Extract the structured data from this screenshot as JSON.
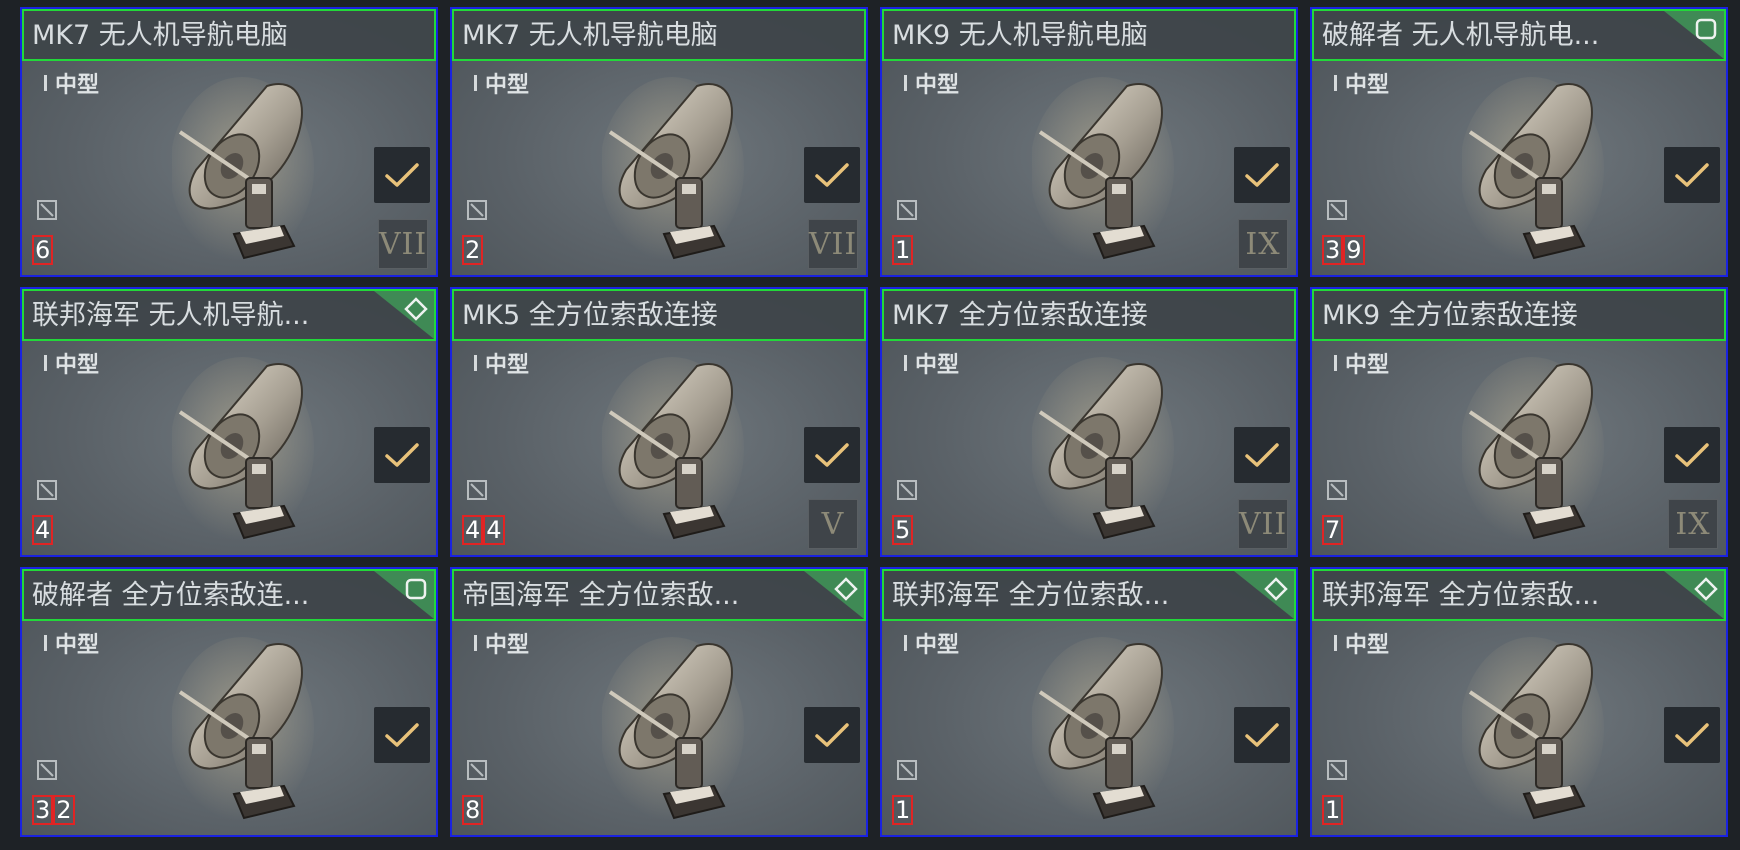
{
  "items": [
    {
      "name": "MK7 无人机导航电脑",
      "size": "中型",
      "quantity": "6",
      "tier": "VII",
      "rarity_icon": null,
      "checked": true
    },
    {
      "name": "MK7 无人机导航电脑",
      "size": "中型",
      "quantity": "2",
      "tier": "VII",
      "rarity_icon": null,
      "checked": true
    },
    {
      "name": "MK9 无人机导航电脑",
      "size": "中型",
      "quantity": "1",
      "tier": "IX",
      "rarity_icon": null,
      "checked": true
    },
    {
      "name": "破解者 无人机导航电...",
      "size": "中型",
      "quantity": "39",
      "tier": null,
      "rarity_icon": "square-icon",
      "checked": true
    },
    {
      "name": "联邦海军 无人机导航...",
      "size": "中型",
      "quantity": "4",
      "tier": null,
      "rarity_icon": "diamond-icon",
      "checked": true
    },
    {
      "name": "MK5 全方位索敌连接",
      "size": "中型",
      "quantity": "44",
      "tier": "V",
      "rarity_icon": null,
      "checked": true
    },
    {
      "name": "MK7 全方位索敌连接",
      "size": "中型",
      "quantity": "5",
      "tier": "VII",
      "rarity_icon": null,
      "checked": true
    },
    {
      "name": "MK9 全方位索敌连接",
      "size": "中型",
      "quantity": "7",
      "tier": "IX",
      "rarity_icon": null,
      "checked": true
    },
    {
      "name": "破解者 全方位索敌连...",
      "size": "中型",
      "quantity": "32",
      "tier": null,
      "rarity_icon": "square-icon",
      "checked": true
    },
    {
      "name": "帝国海军 全方位索敌...",
      "size": "中型",
      "quantity": "8",
      "tier": null,
      "rarity_icon": "diamond-icon",
      "checked": true
    },
    {
      "name": "联邦海军 全方位索敌...",
      "size": "中型",
      "quantity": "1",
      "tier": null,
      "rarity_icon": "diamond-icon",
      "checked": true
    },
    {
      "name": "联邦海军 全方位索敌...",
      "size": "中型",
      "quantity": "1",
      "tier": null,
      "rarity_icon": "diamond-icon",
      "checked": true
    }
  ],
  "colors": {
    "card_border": "#1a22e0",
    "title_border": "#22d83a",
    "quantity_border": "#e02424",
    "corner_accent": "#3f8a55",
    "check_color": "#e8c27a"
  }
}
